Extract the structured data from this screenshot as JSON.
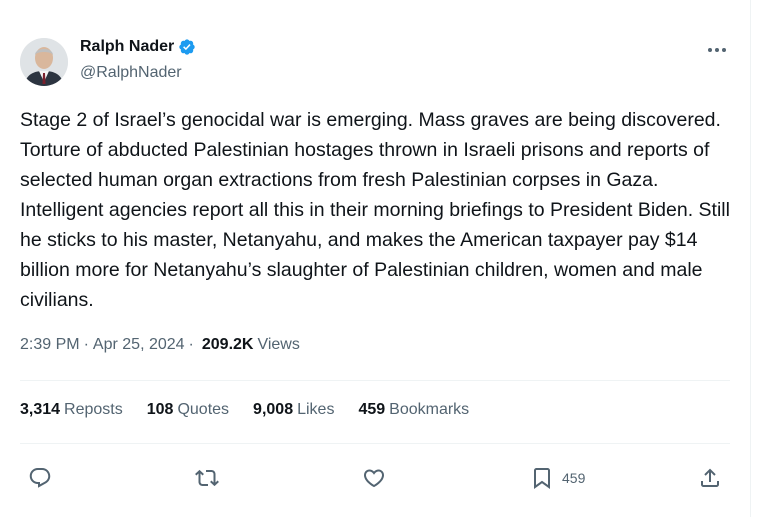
{
  "author": {
    "name": "Ralph Nader",
    "handle": "@RalphNader"
  },
  "tweet": {
    "text": "Stage 2 of Israel’s genocidal war is emerging. Mass graves are being discovered. Torture of abducted Palestinian hostages thrown in Israeli prisons and reports of selected human organ extractions from fresh Palestinian corpses in Gaza. Intelligent agencies report all this in their morning briefings to President Biden. Still he sticks to his master, Netanyahu, and makes the American taxpayer pay $14 billion more for Netanyahu’s slaughter of Palestinian children, women and male civilians."
  },
  "meta": {
    "time": "2:39 PM",
    "separator": "·",
    "date": "Apr 25, 2024",
    "views_count": "209.2K",
    "views_label": "Views"
  },
  "stats": {
    "reposts_count": "3,314",
    "reposts_label": "Reposts",
    "quotes_count": "108",
    "quotes_label": "Quotes",
    "likes_count": "9,008",
    "likes_label": "Likes",
    "bookmarks_count": "459",
    "bookmarks_label": "Bookmarks"
  },
  "actions": {
    "bookmark_count": "459"
  },
  "icons": {
    "verified": "verified-badge-icon",
    "more": "more-icon",
    "reply": "reply-icon",
    "repost": "repost-icon",
    "like": "like-icon",
    "bookmark": "bookmark-icon",
    "share": "share-icon"
  },
  "colors": {
    "verified": "#1d9bf0",
    "text": "#0f1419",
    "secondary": "#536471",
    "divider": "#eff3f4"
  }
}
